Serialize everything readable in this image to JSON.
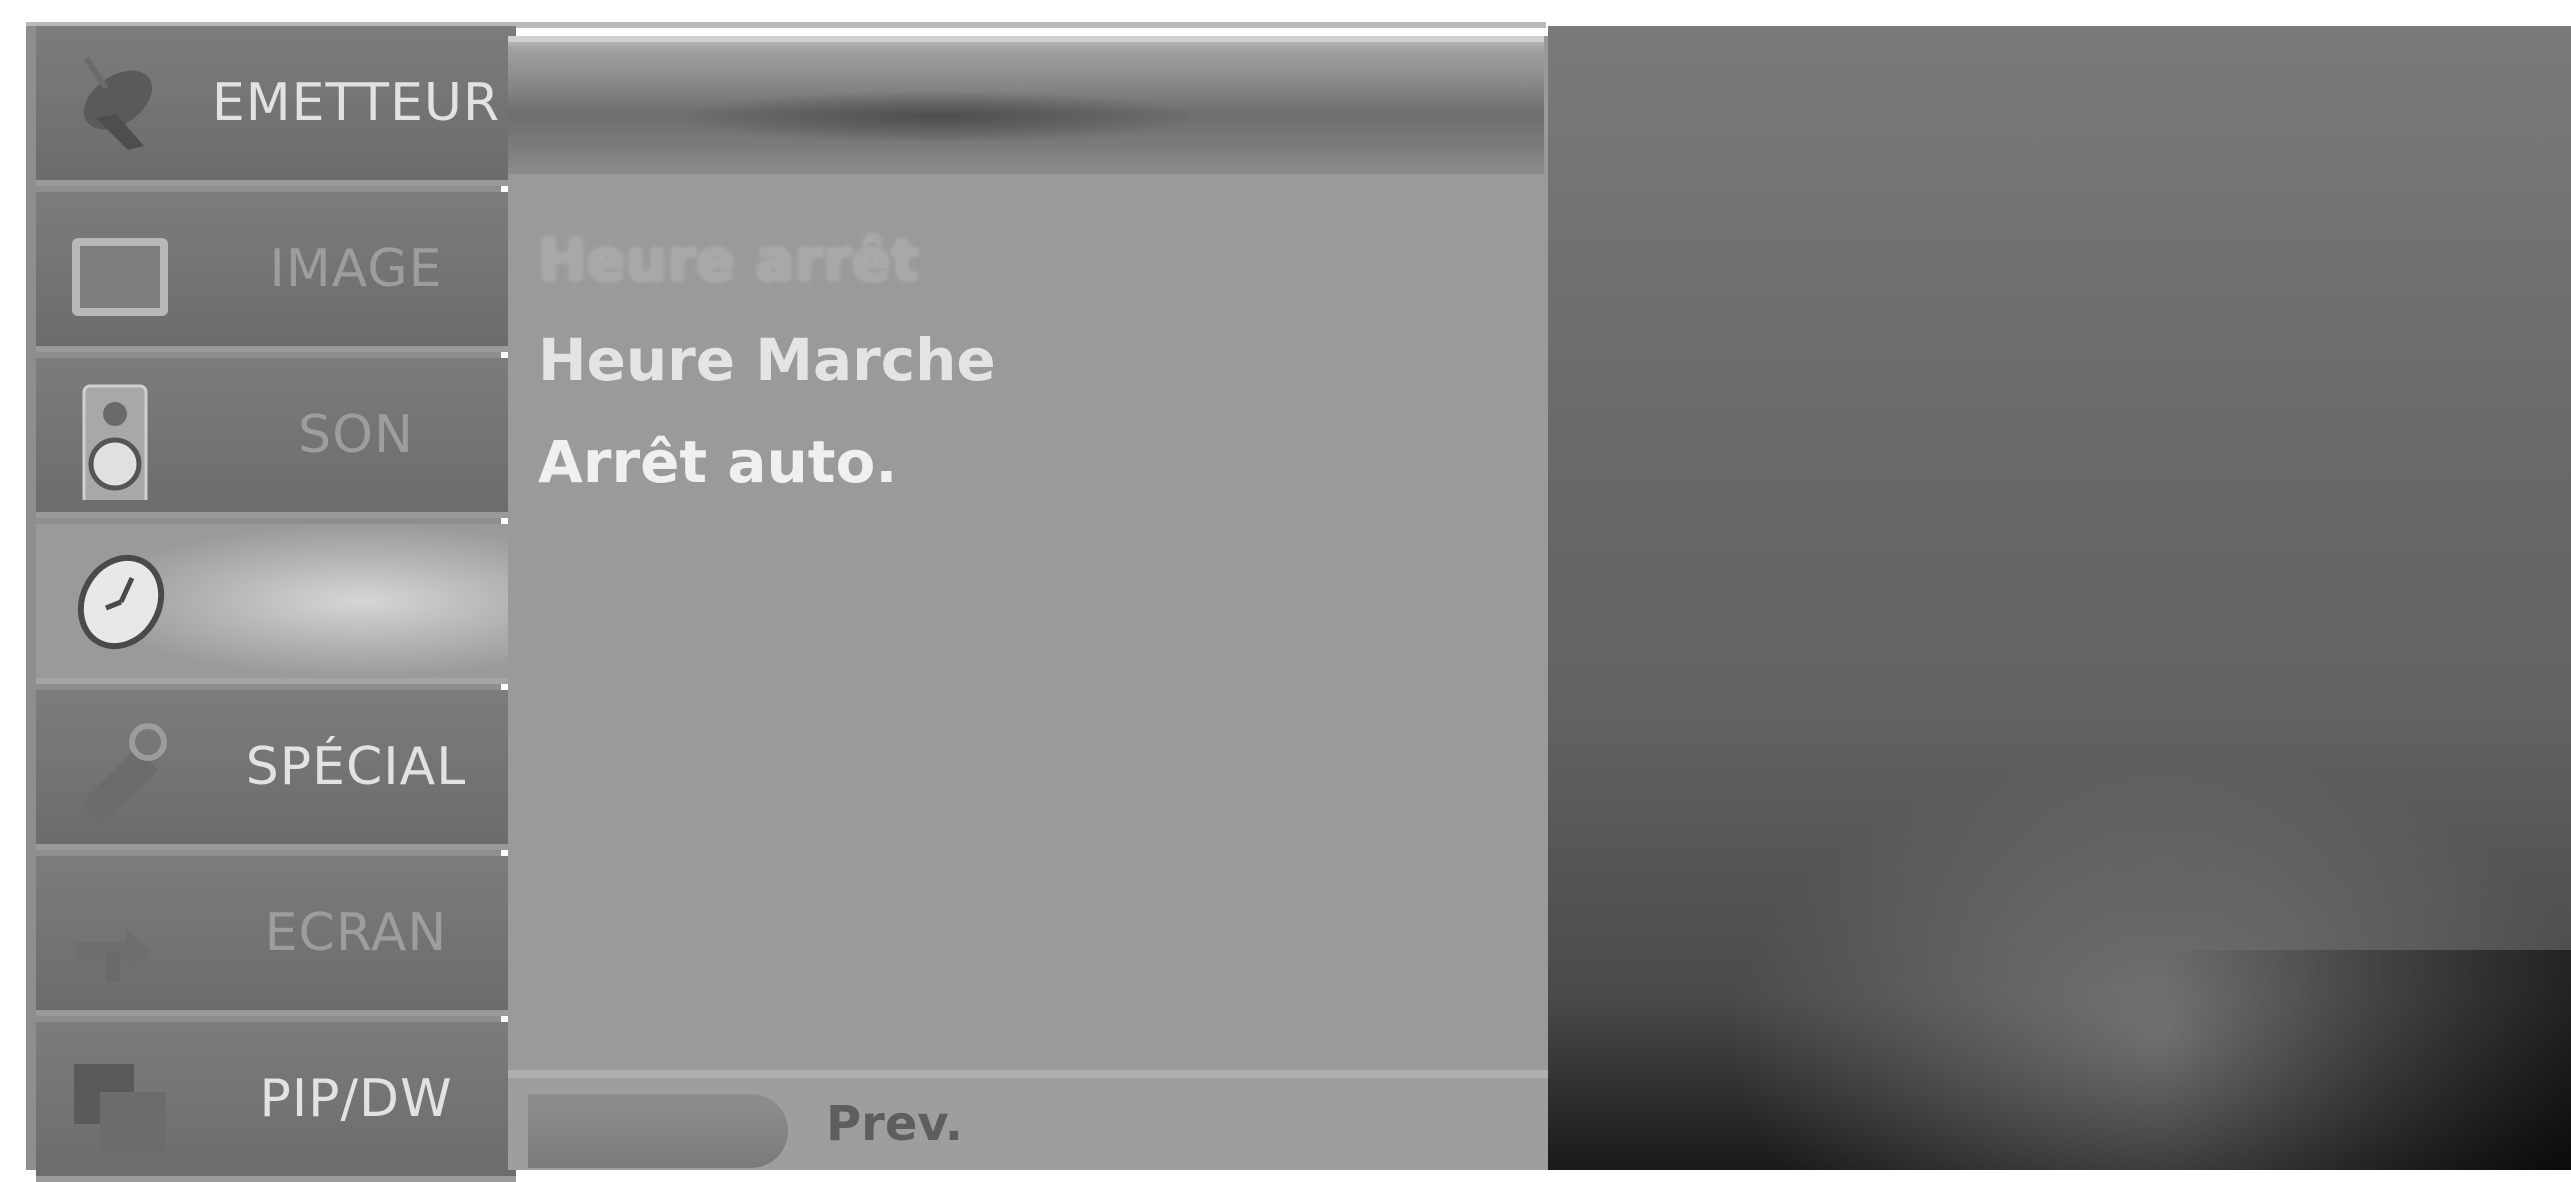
{
  "categories": [
    {
      "label": "EMETTEUR",
      "icon": "satellite-dish-icon"
    },
    {
      "label": "IMAGE",
      "icon": "tv-screen-icon"
    },
    {
      "label": "SON",
      "icon": "speaker-icon"
    },
    {
      "label": "",
      "icon": "clock-icon"
    },
    {
      "label": "SPÉCIAL",
      "icon": "tag-icon"
    },
    {
      "label": "ECRAN",
      "icon": "arrows-icon"
    },
    {
      "label": "PIP/DW",
      "icon": "pip-windows-icon"
    }
  ],
  "selected_category_index": 3,
  "submenu": {
    "items": [
      "Heure arrêt",
      "Heure Marche",
      "Arrêt auto."
    ]
  },
  "footer": {
    "prev_label": "Prev."
  }
}
